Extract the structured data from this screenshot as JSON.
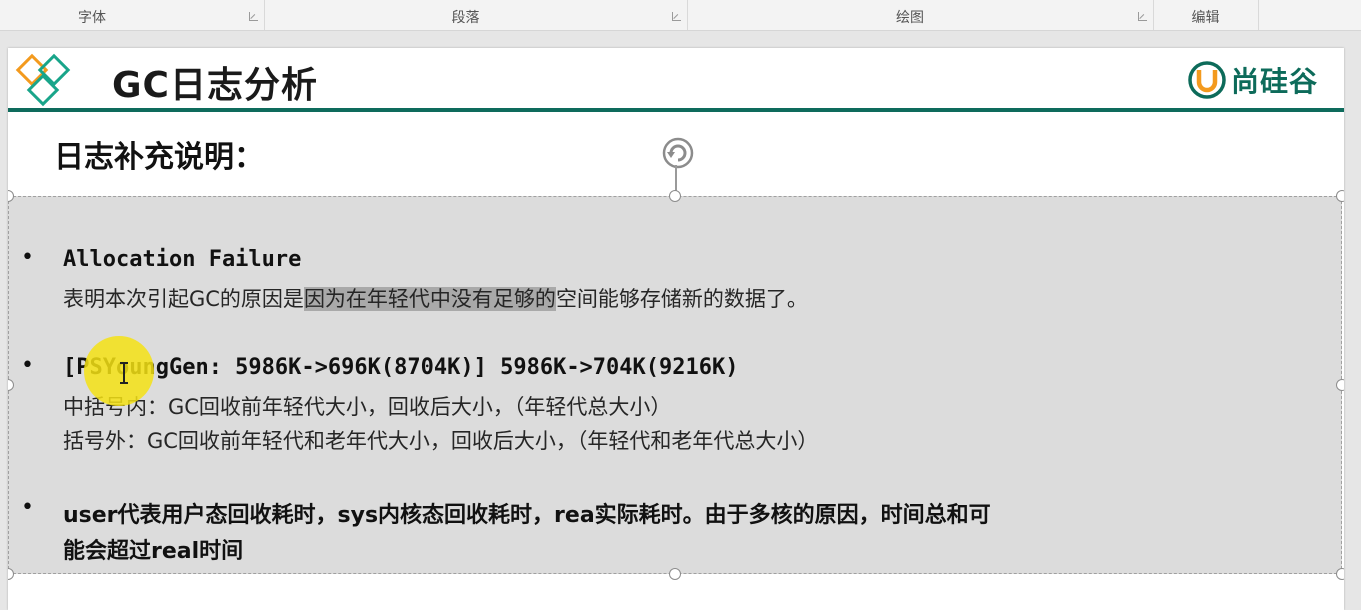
{
  "ribbon": {
    "groups": [
      {
        "label": "字体"
      },
      {
        "label": "段落"
      },
      {
        "label": "绘图"
      },
      {
        "label": "编辑"
      }
    ]
  },
  "slide": {
    "title": "GC日志分析",
    "brand": "尚硅谷",
    "subtitle": "日志补充说明：",
    "bullet_char": "•",
    "bullets": [
      {
        "head": "Allocation Failure",
        "body_prefix": "表明本次引起GC的原因是",
        "body_highlight": "因为在年轻代中没有足够的",
        "body_suffix": "空间能够存储新的数据了。"
      },
      {
        "head": "[PSYoungGen: 5986K->696K(8704K)] 5986K->704K(9216K)",
        "line2": "中括号内：GC回收前年轻代大小，回收后大小，（年轻代总大小）",
        "line3": "括号外：GC回收前年轻代和老年代大小，回收后大小，（年轻代和老年代总大小）"
      },
      {
        "line1": "user代表用户态回收耗时，sys内核态回收耗时，rea实际耗时。由于多核的原因，时间总和可",
        "line2": "能会超过real时间"
      }
    ]
  },
  "colors": {
    "accent": "#0e6b5c",
    "logo_orange": "#f39a1e",
    "logo_teal": "#19a58a",
    "highlight": "#a9a9a9",
    "pointer": "#f5e214"
  }
}
